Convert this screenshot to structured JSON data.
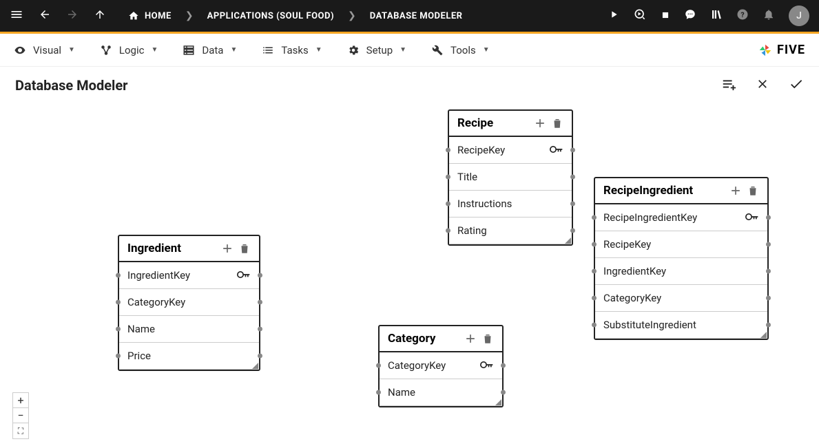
{
  "breadcrumb": {
    "home": "HOME",
    "applications": "APPLICATIONS (SOUL FOOD)",
    "current": "DATABASE MODELER"
  },
  "avatar_initial": "J",
  "toolbar": {
    "visual": "Visual",
    "logic": "Logic",
    "data": "Data",
    "tasks": "Tasks",
    "setup": "Setup",
    "tools": "Tools"
  },
  "brand": "FIVE",
  "page_title": "Database Modeler",
  "entities": {
    "ingredient": {
      "title": "Ingredient",
      "fields": [
        "IngredientKey",
        "CategoryKey",
        "Name",
        "Price"
      ]
    },
    "recipe": {
      "title": "Recipe",
      "fields": [
        "RecipeKey",
        "Title",
        "Instructions",
        "Rating"
      ]
    },
    "category": {
      "title": "Category",
      "fields": [
        "CategoryKey",
        "Name"
      ]
    },
    "recipe_ingredient": {
      "title": "RecipeIngredient",
      "fields": [
        "RecipeIngredientKey",
        "RecipeKey",
        "IngredientKey",
        "CategoryKey",
        "SubstituteIngredient"
      ]
    }
  }
}
